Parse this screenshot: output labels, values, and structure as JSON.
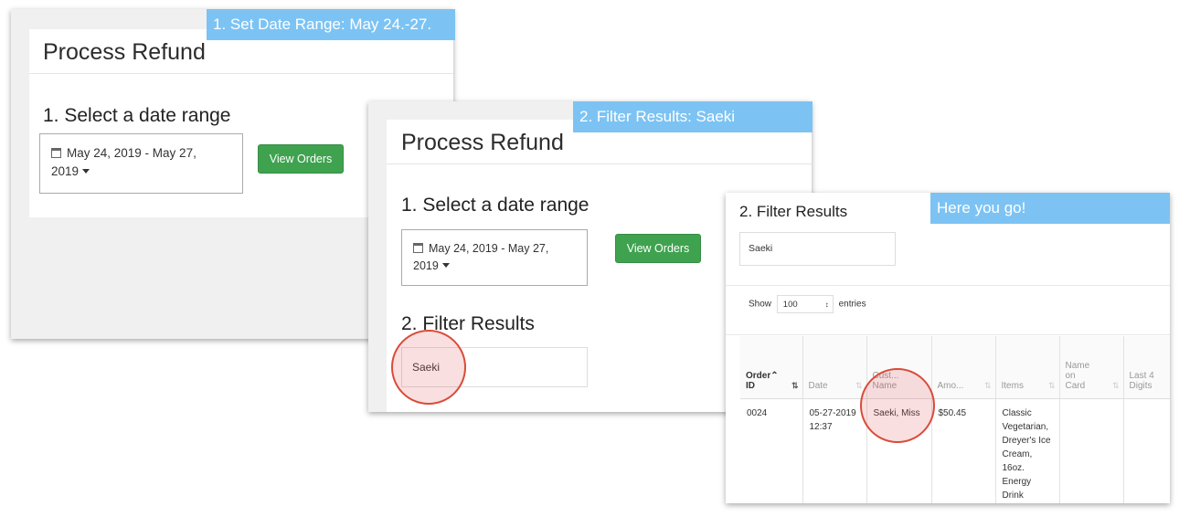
{
  "captions": {
    "step1": "1. Set Date Range: May 24.-27.",
    "step2": "2. Filter Results: Saeki",
    "step3": "Here you go!"
  },
  "panel1": {
    "title": "Process Refund",
    "section1": "1. Select a date range",
    "date_line1": "May 24, 2019 - May 27,",
    "date_line2": "2019",
    "view_orders": "View Orders"
  },
  "panel2": {
    "title": "Process Refund",
    "section1": "1. Select a date range",
    "date_line1": "May 24, 2019 - May 27,",
    "date_line2": "2019",
    "view_orders": "View Orders",
    "section2": "2. Filter Results",
    "filter_value": "Saeki"
  },
  "panel3": {
    "section2": "2. Filter Results",
    "filter_value": "Saeki",
    "show_label": "Show",
    "entries_value": "100",
    "entries_label": "entries",
    "columns": [
      {
        "l1": "Order",
        "l2": "ID"
      },
      {
        "l1": "",
        "l2": "Date"
      },
      {
        "l1": "Cust...",
        "l2": "Name"
      },
      {
        "l1": "",
        "l2": "Amo..."
      },
      {
        "l1": "",
        "l2": "Items"
      },
      {
        "l1": "Name",
        "l2": "on",
        "l3": "Card"
      },
      {
        "l1": "Last 4",
        "l2": "Digits"
      }
    ],
    "rows": [
      {
        "order_id": "0024",
        "date": "05-27-2019",
        "time": "12:37",
        "customer": "Saeki, Miss",
        "amount": "$50.45",
        "items": [
          "Classic",
          "Vegetarian,",
          "Dreyer's Ice",
          "Cream,",
          "16oz.",
          "Energy",
          "Drink"
        ],
        "name_on_card": "",
        "last4": ""
      }
    ]
  },
  "icons": [
    "calendar-icon",
    "caret-down-icon",
    "sort-up-icon",
    "sort-icon",
    "select-arrows-icon"
  ],
  "colors": {
    "caption_bg": "#7cc3f3",
    "button_green": "#3fa24f",
    "highlight_red": "#d94b3a"
  }
}
